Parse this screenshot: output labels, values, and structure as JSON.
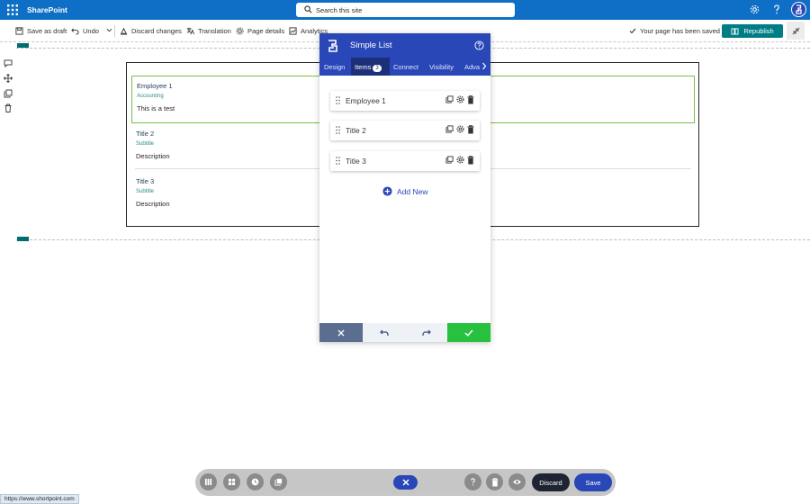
{
  "suitebar": {
    "brand": "SharePoint",
    "search_placeholder": "Search this site",
    "colors": {
      "bar": "#0f6fc6"
    }
  },
  "commandbar": {
    "save_draft": "Save as draft",
    "undo": "Undo",
    "discard": "Discard changes",
    "translation": "Translation",
    "page_details": "Page details",
    "analytics": "Analytics",
    "saved_status": "Your page has been saved",
    "republish": "Republish"
  },
  "canvas": {
    "items": [
      {
        "title": "Employee 1",
        "subtitle": "Accounting",
        "description": "This is a test"
      },
      {
        "title": "Title 2",
        "subtitle": "Subtitle",
        "description": "Description"
      },
      {
        "title": "Title 3",
        "subtitle": "Subtitle",
        "description": "Description"
      }
    ]
  },
  "panel": {
    "title": "Simple List",
    "tabs": [
      {
        "label": "Design"
      },
      {
        "label": "Items",
        "count": "3"
      },
      {
        "label": "Connect"
      },
      {
        "label": "Visibility"
      },
      {
        "label": "Adva"
      }
    ],
    "items": [
      {
        "label": "Employee 1"
      },
      {
        "label": "Title 2"
      },
      {
        "label": "Title 3"
      }
    ],
    "add_new": "Add New"
  },
  "bottom_toolbar": {
    "discard": "Discard",
    "save": "Save"
  },
  "status_url": "https://www.shortpoint.com",
  "icons": [
    "waffle-icon",
    "search-icon",
    "gear-icon",
    "help-icon",
    "save-icon",
    "undo-icon",
    "discard-icon",
    "translation-icon",
    "page-details-icon",
    "analytics-icon",
    "check-icon",
    "book-icon",
    "collapse-icon",
    "shortpoint-logo-icon",
    "grip-icon",
    "duplicate-icon",
    "trash-icon",
    "plus-circle-icon",
    "close-icon",
    "redo-icon",
    "eye-icon",
    "clock-icon",
    "columns-icon",
    "grid-icon"
  ]
}
